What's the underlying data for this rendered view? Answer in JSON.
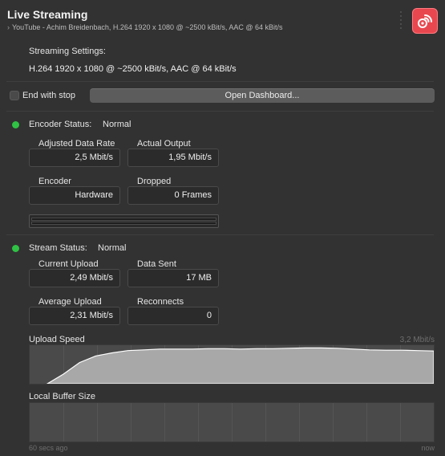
{
  "header": {
    "title": "Live Streaming",
    "subtitle": "YouTube - Achim Breidenbach, H.264 1920 x 1080 @ ~2500 kBit/s, AAC @ 64 kBit/s"
  },
  "settings": {
    "label": "Streaming Settings:",
    "value": "H.264 1920 x 1080 @ ~2500 kBit/s, AAC @ 64 kBit/s"
  },
  "controls": {
    "end_with_stop_label": "End with stop",
    "end_with_stop_checked": false,
    "open_dashboard_label": "Open Dashboard..."
  },
  "encoder": {
    "status_label": "Encoder Status:",
    "status_value": "Normal",
    "status_color": "#2fc244",
    "fields": [
      {
        "label": "Adjusted Data Rate",
        "value": "2,5 Mbit/s"
      },
      {
        "label": "Actual Output",
        "value": "1,95 Mbit/s"
      },
      {
        "label": "Encoder",
        "value": "Hardware"
      },
      {
        "label": "Dropped",
        "value": "0 Frames"
      }
    ]
  },
  "stream": {
    "status_label": "Stream Status:",
    "status_value": "Normal",
    "status_color": "#2fc244",
    "fields": [
      {
        "label": "Current Upload",
        "value": "2,49 Mbit/s"
      },
      {
        "label": "Data Sent",
        "value": "17 MB"
      },
      {
        "label": "Average Upload",
        "value": "2,31 Mbit/s"
      },
      {
        "label": "Reconnects",
        "value": "0"
      }
    ]
  },
  "upload_graph": {
    "label": "Upload Speed",
    "max_label": "3,2 Mbit/s",
    "values": [
      0,
      0.25,
      0.55,
      0.72,
      0.8,
      0.86,
      0.88,
      0.9,
      0.9,
      0.9,
      0.91,
      0.91,
      0.9,
      0.91,
      0.91,
      0.92,
      0.93,
      0.93,
      0.92,
      0.9,
      0.88,
      0.87,
      0.87,
      0.86,
      0.85
    ]
  },
  "buffer_graph": {
    "label": "Local Buffer Size"
  },
  "time_axis": {
    "start": "60 secs ago",
    "end": "now"
  }
}
